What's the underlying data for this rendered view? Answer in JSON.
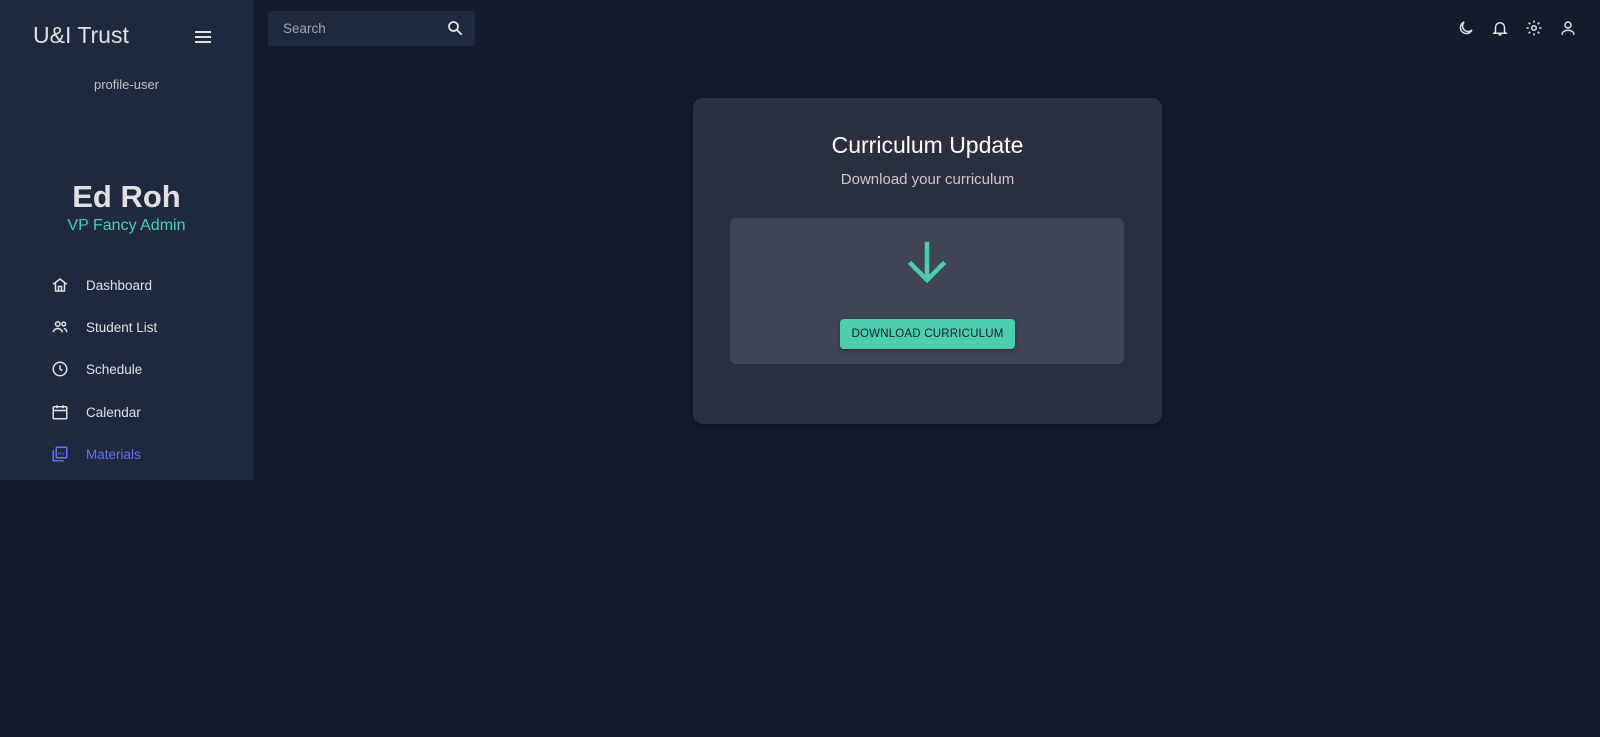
{
  "app": {
    "brand": "U&I Trust"
  },
  "sidebar": {
    "avatar_alt": "profile-user",
    "user_name": "Ed Roh",
    "user_role": "VP Fancy Admin",
    "items": [
      {
        "label": "Dashboard",
        "icon": "home-icon"
      },
      {
        "label": "Student List",
        "icon": "people-icon"
      },
      {
        "label": "Schedule",
        "icon": "clock-icon"
      },
      {
        "label": "Calendar",
        "icon": "calendar-icon"
      },
      {
        "label": "Materials",
        "icon": "pdf-library-icon",
        "active": true
      }
    ]
  },
  "topbar": {
    "search_placeholder": "Search",
    "icons": [
      "dark-mode-icon",
      "notifications-icon",
      "settings-icon",
      "person-icon"
    ]
  },
  "card": {
    "title": "Curriculum Update",
    "subtitle": "Download your curriculum",
    "button_label": "DOWNLOAD CURRICULUM"
  },
  "colors": {
    "background": "#141b2d",
    "sidebar": "#1f2a40",
    "accent_green": "#4cceac",
    "active_nav": "#6870fa"
  }
}
